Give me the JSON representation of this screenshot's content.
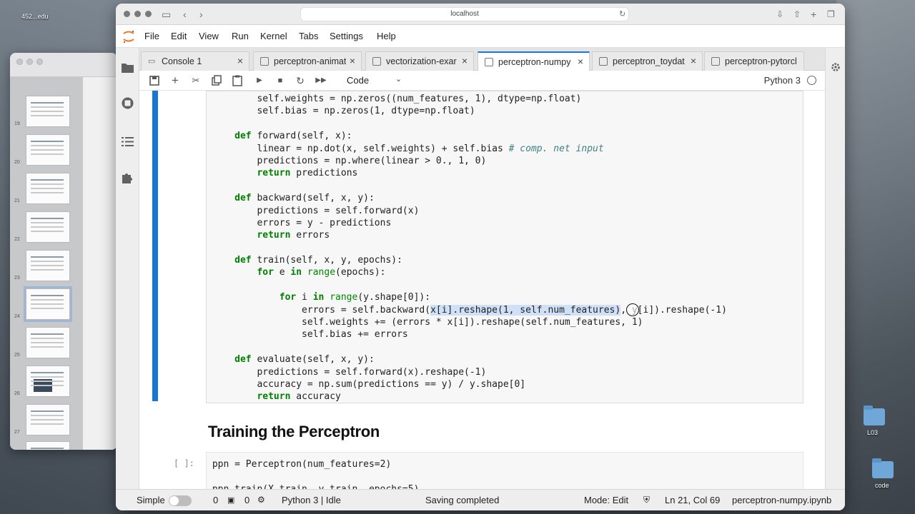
{
  "desktop": {
    "top_left_label": "452...edu",
    "folders": [
      {
        "label": "L03"
      },
      {
        "label": "code"
      }
    ]
  },
  "pdf_viewer": {
    "thumb_numbers": [
      "19",
      "20",
      "21",
      "22",
      "23",
      "24",
      "25",
      "26",
      "27",
      "28"
    ]
  },
  "browser": {
    "url": "localhost"
  },
  "menu": [
    "File",
    "Edit",
    "View",
    "Run",
    "Kernel",
    "Tabs",
    "Settings",
    "Help"
  ],
  "tabs": [
    {
      "label": "Console 1",
      "active": false
    },
    {
      "label": "perceptron-animat",
      "active": false
    },
    {
      "label": "vectorization-exar",
      "active": false
    },
    {
      "label": "perceptron-numpy",
      "active": true
    },
    {
      "label": "perceptron_toydat",
      "active": false
    },
    {
      "label": "perceptron-pytorcl",
      "active": false
    }
  ],
  "toolbar": {
    "cell_type": "Code",
    "kernel": "Python 3"
  },
  "code_lines": [
    "        self.weights = np.zeros((num_features, 1), dtype=np.float)",
    "        self.bias = np.zeros(1, dtype=np.float)",
    "",
    "    def forward(self, x):",
    "        linear = np.dot(x, self.weights) + self.bias # comp. net input",
    "        predictions = np.where(linear > 0., 1, 0)",
    "        return predictions",
    "",
    "    def backward(self, x, y):",
    "        predictions = self.forward(x)",
    "        errors = y - predictions",
    "        return errors",
    "",
    "    def train(self, x, y, epochs):",
    "        for e in range(epochs):",
    "",
    "            for i in range(y.shape[0]):",
    "                errors = self.backward(x[i].reshape(1, self.num_features), y[i]).reshape(-1)",
    "                self.weights += (errors * x[i]).reshape(self.num_features, 1)",
    "                self.bias += errors",
    "",
    "    def evaluate(self, x, y):",
    "        predictions = self.forward(x).reshape(-1)",
    "        accuracy = np.sum(predictions == y) / y.shape[0]",
    "        return accuracy"
  ],
  "markdown": {
    "heading": "Training the Perceptron"
  },
  "next_cell": {
    "prompt": "[ ]:",
    "lines": [
      "ppn = Perceptron(num_features=2)",
      "",
      "ppn.train(X_train, y_train, epochs=5)"
    ]
  },
  "status": {
    "mode_label": "Simple",
    "count_a": "0",
    "count_b": "0",
    "kernel_status": "Python 3 | Idle",
    "saving": "Saving completed",
    "mode": "Mode: Edit",
    "position": "Ln 21, Col 69",
    "filename": "perceptron-numpy.ipynb"
  }
}
